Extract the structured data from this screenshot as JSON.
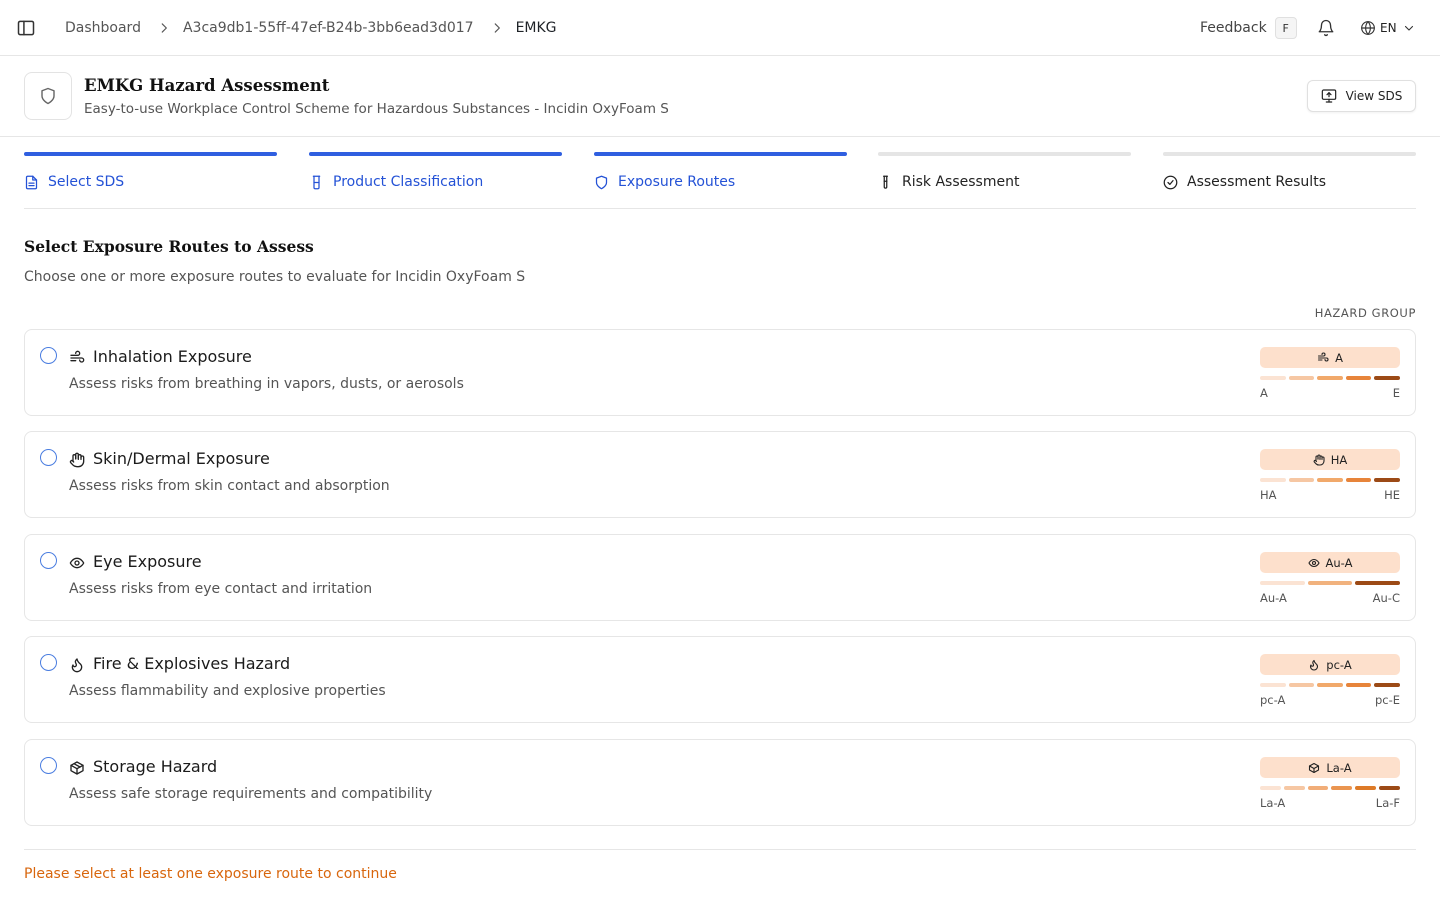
{
  "topbar": {
    "breadcrumb": [
      "Dashboard",
      "A3ca9db1-55ff-47ef-B24b-3bb6ead3d017",
      "EMKG"
    ],
    "feedback_label": "Feedback",
    "feedback_shortcut": "F",
    "language": "EN"
  },
  "header": {
    "title": "EMKG Hazard Assessment",
    "subtitle": "Easy-to-use Workplace Control Scheme for Hazardous Substances - Incidin OxyFoam S",
    "view_sds_label": "View SDS"
  },
  "steps": [
    {
      "label": "Select SDS",
      "icon": "document-icon",
      "state": "active"
    },
    {
      "label": "Product Classification",
      "icon": "flask-icon",
      "state": "active"
    },
    {
      "label": "Exposure Routes",
      "icon": "shield-icon",
      "state": "active"
    },
    {
      "label": "Risk Assessment",
      "icon": "test-tube-icon",
      "state": "inactive"
    },
    {
      "label": "Assessment Results",
      "icon": "check-circle-icon",
      "state": "inactive"
    }
  ],
  "section": {
    "title": "Select Exposure Routes to Assess",
    "description": "Choose one or more exposure routes to evaluate for Incidin OxyFoam S",
    "hazard_group_label": "HAZARD GROUP"
  },
  "routes": [
    {
      "title": "Inhalation Exposure",
      "description": "Assess risks from breathing in vapors, dusts, or aerosols",
      "icon": "wind-icon",
      "hazard_group": "A",
      "scale_min": "A",
      "scale_max": "E",
      "checked": false
    },
    {
      "title": "Skin/Dermal Exposure",
      "description": "Assess risks from skin contact and absorption",
      "icon": "hand-icon",
      "hazard_group": "HA",
      "scale_min": "HA",
      "scale_max": "HE",
      "checked": false
    },
    {
      "title": "Eye Exposure",
      "description": "Assess risks from eye contact and irritation",
      "icon": "eye-icon",
      "hazard_group": "Au-A",
      "scale_min": "Au-A",
      "scale_max": "Au-C",
      "checked": false
    },
    {
      "title": "Fire & Explosives Hazard",
      "description": "Assess flammability and explosive properties",
      "icon": "flame-icon",
      "hazard_group": "pc-A",
      "scale_min": "pc-A",
      "scale_max": "pc-E",
      "checked": false
    },
    {
      "title": "Storage Hazard",
      "description": "Assess safe storage requirements and compatibility",
      "icon": "package-icon",
      "hazard_group": "La-A",
      "scale_min": "La-A",
      "scale_max": "La-F",
      "checked": false
    }
  ],
  "scale_colors": {
    "five": [
      "#fbe3d3",
      "#f6c7a3",
      "#f1a96b",
      "#e7843a",
      "#9c4a16"
    ],
    "three": [
      "#fbe3d3",
      "#f1b27e",
      "#9c4a16"
    ],
    "six": [
      "#fbe3d3",
      "#f6c7a3",
      "#f1ad78",
      "#ea9550",
      "#dd7a27",
      "#9c4a16"
    ]
  },
  "colors": {
    "accent": "#2f5fe0",
    "warning_text": "#d8660d",
    "badge_bg": "#fde0cc"
  },
  "footer": {
    "message": "Please select at least one exposure route to continue"
  }
}
